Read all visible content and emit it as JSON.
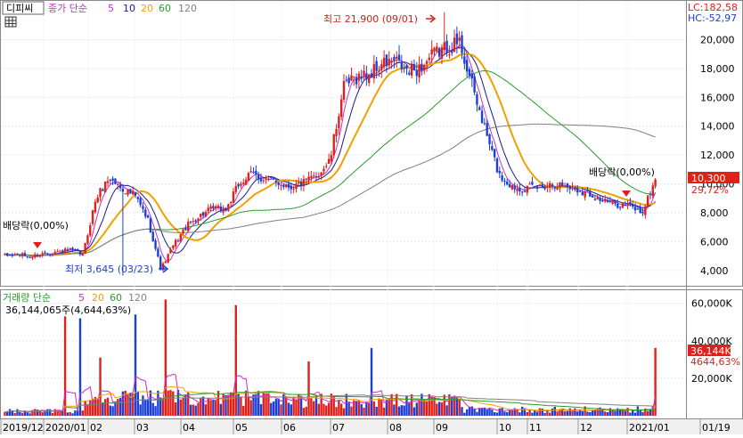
{
  "price_panel": {
    "name": "디피씨",
    "legend_prefix": "종가 단순",
    "ma_periods": [
      "5",
      "10",
      "20",
      "60",
      "120"
    ],
    "lc_label": "LC:182,58",
    "hc_label": "HC:-52,97",
    "high_annotation": "최고 21,900 (09/01)",
    "low_annotation": "최저 3,645 (03/23)",
    "dividend_left": "배당락(0,00%)",
    "dividend_right": "배당락(0,00%)",
    "current_price": "10,300",
    "current_change": "29,72%"
  },
  "volume_panel": {
    "legend_prefix": "거래량 단순",
    "ma_periods": [
      "5",
      "20",
      "60",
      "120"
    ],
    "summary": "36,144,065주(4,644,63%)",
    "current_volume": "36,144K",
    "current_pct": "4644,63%"
  },
  "colors": {
    "up": "#e0201b",
    "down": "#1c3fd8",
    "ma5": "#c82fc8",
    "ma10": "#1a1a8c",
    "ma20": "#f0a000",
    "ma60": "#2a9a2a",
    "ma120": "#808080"
  },
  "chart_data": [
    {
      "type": "candlestick",
      "title": "디피씨",
      "y_ticks": [
        "4,000",
        "6,000",
        "8,000",
        "10,000",
        "12,000",
        "14,000",
        "16,000",
        "18,000",
        "20,000"
      ],
      "ylim": [
        3000,
        22500
      ],
      "x_ticks": [
        "2019/12",
        "2020/01",
        "02",
        "03",
        "04",
        "05",
        "06",
        "07",
        "08",
        "09",
        "10",
        "11",
        "12",
        "2021/01",
        "01/19"
      ],
      "series": [
        {
          "name": "종가",
          "approx_weekly_close": [
            5000,
            5100,
            4950,
            5200,
            5300,
            5400,
            5100,
            9000,
            10400,
            9700,
            9200,
            7500,
            4100,
            5800,
            7100,
            7800,
            8300,
            8200,
            10000,
            10700,
            10300,
            10100,
            9800,
            10100,
            10600,
            11600,
            16600,
            17400,
            17600,
            18300,
            18500,
            17700,
            18100,
            19000,
            19500,
            19800,
            16500,
            13500,
            10600,
            9800,
            9700,
            9800,
            10000,
            9900,
            9600,
            9300,
            8800,
            8600,
            8500,
            8000,
            10300
          ]
        },
        {
          "name": "단순 5"
        },
        {
          "name": "단순 10"
        },
        {
          "name": "단순 20"
        },
        {
          "name": "단순 60"
        },
        {
          "name": "단순 120"
        }
      ],
      "annotations": [
        {
          "text": "최고 21,900 (09/01)",
          "value": 21900
        },
        {
          "text": "최저 3,645 (03/23)",
          "value": 3645
        },
        {
          "text": "배당락(0,00%)"
        },
        {
          "text": "배당락(0,00%)"
        }
      ]
    },
    {
      "type": "bar",
      "title": "거래량",
      "y_ticks": [
        "20,000K",
        "40,000K",
        "60,000K"
      ],
      "ylim": [
        0,
        66000
      ],
      "unit": "K",
      "series": [
        {
          "name": "거래량",
          "approx_spikes": [
            {
              "period": "02",
              "value": 53000
            },
            {
              "period": "02",
              "value": 52000
            },
            {
              "period": "03",
              "value": 31000
            },
            {
              "period": "04",
              "value": 54000
            },
            {
              "period": "05",
              "value": 62000
            },
            {
              "period": "07",
              "value": 59000
            },
            {
              "period": "09",
              "value": 29000
            },
            {
              "period": "2021/01",
              "value": 36144
            }
          ]
        },
        {
          "name": "단순 5"
        },
        {
          "name": "단순 20"
        },
        {
          "name": "단순 60"
        },
        {
          "name": "단순 120"
        }
      ]
    }
  ]
}
